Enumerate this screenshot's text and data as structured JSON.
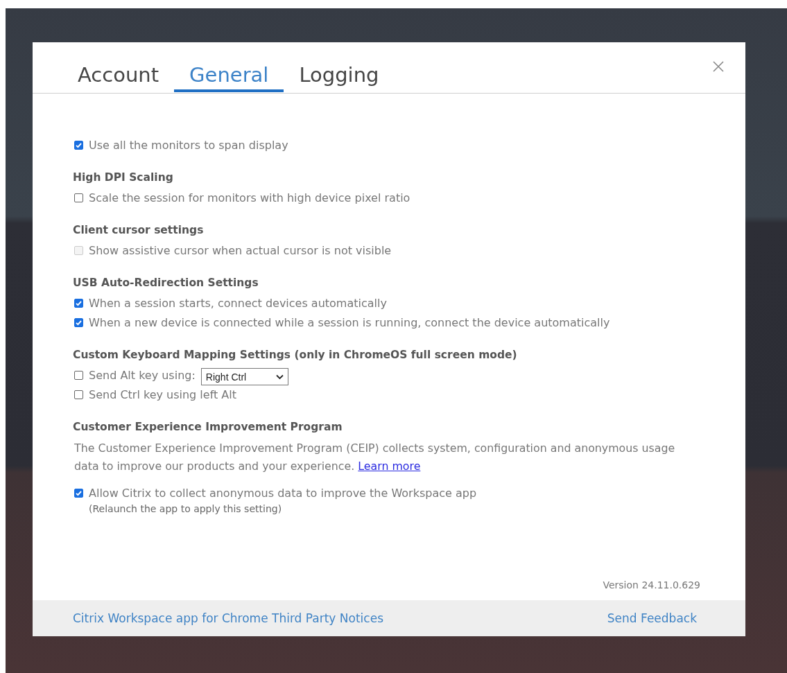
{
  "tabs": [
    {
      "label": "Account",
      "selected": false
    },
    {
      "label": "General",
      "selected": true
    },
    {
      "label": "Logging",
      "selected": false
    }
  ],
  "sections": [
    {
      "items": [
        {
          "kind": "checkbox",
          "label": "Use all the monitors to span display",
          "checked": true,
          "disabled": false
        }
      ]
    },
    {
      "heading": "High DPI Scaling",
      "items": [
        {
          "kind": "checkbox",
          "label": "Scale the session for monitors with high device pixel ratio",
          "checked": false,
          "disabled": false
        }
      ]
    },
    {
      "heading": "Client cursor settings",
      "items": [
        {
          "kind": "checkbox",
          "label": "Show assistive cursor when actual cursor is not visible",
          "checked": false,
          "disabled": true
        }
      ]
    },
    {
      "heading": "USB Auto-Redirection Settings",
      "items": [
        {
          "kind": "checkbox",
          "label": "When a session starts, connect devices automatically",
          "checked": true,
          "disabled": false
        },
        {
          "kind": "checkbox",
          "label": "When a new device is connected while a session is running, connect the device automatically",
          "checked": true,
          "disabled": false
        }
      ]
    },
    {
      "heading": "Custom Keyboard Mapping Settings (only in ChromeOS full screen mode)",
      "items": [
        {
          "kind": "checkbox_select",
          "label": "Send Alt key using:",
          "checked": false,
          "disabled": false,
          "select": "Right Ctrl"
        },
        {
          "kind": "checkbox",
          "label": "Send Ctrl key using left Alt",
          "checked": false,
          "disabled": false
        }
      ]
    },
    {
      "heading": "Customer Experience Improvement Program",
      "items": [
        {
          "kind": "paragraph",
          "text": "The Customer Experience Improvement Program (CEIP) collects system, configuration and anonymous usage data to improve our products and your experience.",
          "link": "Learn more"
        },
        {
          "kind": "checkbox",
          "label": "Allow Citrix to collect anonymous data to improve the Workspace app",
          "checked": true,
          "disabled": false,
          "note": "(Relaunch the app to apply this setting)"
        }
      ]
    }
  ],
  "version": "Version 24.11.0.629",
  "footer": {
    "left_link": "Citrix Workspace app for Chrome Third Party Notices",
    "right_link": "Send Feedback"
  }
}
